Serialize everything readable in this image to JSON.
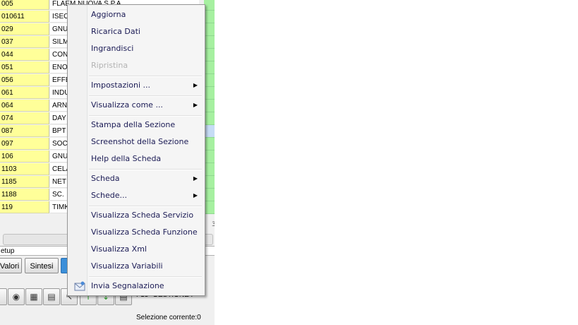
{
  "grid": {
    "rows": [
      {
        "code": "005",
        "name": "FLAEM NUOVA S.P.A."
      },
      {
        "code": "010611",
        "name": "ISEO"
      },
      {
        "code": "029",
        "name": "GNU"
      },
      {
        "code": "037",
        "name": "SILM"
      },
      {
        "code": "044",
        "name": "CON"
      },
      {
        "code": "051",
        "name": "ENO"
      },
      {
        "code": "056",
        "name": "EFFE"
      },
      {
        "code": "061",
        "name": "INDU"
      },
      {
        "code": "064",
        "name": "ARN"
      },
      {
        "code": "074",
        "name": "DAY"
      },
      {
        "code": "087",
        "name": "BPT"
      },
      {
        "code": "097",
        "name": "SOC"
      },
      {
        "code": "106",
        "name": "GNU"
      },
      {
        "code": "1103",
        "name": "CELA"
      },
      {
        "code": "1185",
        "name": "NET"
      },
      {
        "code": "1188",
        "name": "SC."
      },
      {
        "code": "119",
        "name": "TIMK"
      }
    ]
  },
  "setup_label": "etup",
  "tabs": {
    "valori": "Valori",
    "sintesi": "Sintesi"
  },
  "toolbar_text": "F13=GESTIONE F",
  "status_text": "Selezione corrente:0",
  "grip": "3",
  "menu": {
    "aggiorna": "Aggiorna",
    "ricarica": "Ricarica Dati",
    "ingrandisci": "Ingrandisci",
    "ripristina": "Ripristina",
    "impostazioni": "Impostazioni ...",
    "visualizza_come": "Visualizza come ...",
    "stampa": "Stampa della Sezione",
    "screenshot": "Screenshot della Sezione",
    "help": "Help della Scheda",
    "scheda": "Scheda",
    "schede": "Schede...",
    "vis_servizio": "Visualizza Scheda Servizio",
    "vis_funzione": "Visualizza Scheda Funzione",
    "vis_xml": "Visualizza Xml",
    "vis_variabili": "Visualizza Variabili",
    "invia": "Invia Segnalazione"
  },
  "colors": {
    "code_bg": "#ffff99",
    "flag_bg": "#a6f0a0",
    "menu_text": "#1b1b55",
    "disabled": "#b3b3b3"
  }
}
